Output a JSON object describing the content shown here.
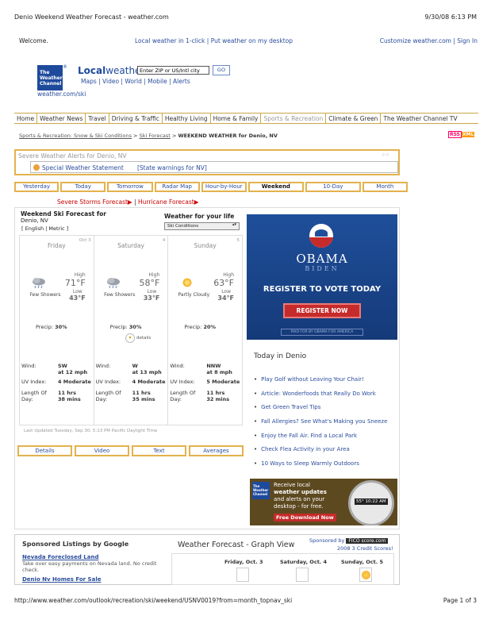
{
  "print_header": {
    "title": "Denio Weekend Weather Forecast - weather.com",
    "datetime": "9/30/08 6:13 PM"
  },
  "welcome": {
    "greeting": "Welcome.",
    "local_links": "Local weather in 1-click  |   Put weather on my desktop",
    "right_links": "Customize weather.com  | Sign In"
  },
  "logo": {
    "brand": "The Weather Channel",
    "reg": "®"
  },
  "local_weather": {
    "title_bold": "Local",
    "title_rest": "weather",
    "zip_value": "Enter ZIP or US/Intl city",
    "go_label": "GO",
    "sub_links": "Maps | Video | World | Mobile | Alerts",
    "site_url": "weather.com/ski"
  },
  "main_nav": [
    "Home",
    "Weather News",
    "Travel",
    "Driving & Traffic",
    "Healthy Living",
    "Home & Family",
    "Sports & Recreation",
    "Climate & Green",
    "The Weather Channel TV"
  ],
  "breadcrumb": {
    "crumb1": "Sports & Recreation: Snow & Ski Conditions",
    "sep": ">",
    "crumb2": "Ski Forecast",
    "current": "WEEKEND WEATHER for Denio, NV"
  },
  "rss": {
    "r": "RSS",
    "x": "XML"
  },
  "alerts": {
    "title": "Severe Weather Alerts for Denio, NV",
    "statement": "Special Weather Statement",
    "state_warnings": "[State warnings for NV]",
    "tiny": "▫ ▫"
  },
  "day_tabs": [
    "Yesterday",
    "Today",
    "Tomorrow",
    "Radar Map",
    "Hour-by-Hour",
    "Weekend",
    "10-Day",
    "Month"
  ],
  "storm_links": {
    "severe": "Severe Storms Forecast",
    "sep": " | ",
    "hurricane": "Hurricane Forecast"
  },
  "ski": {
    "title": "Weekend Ski Forecast for",
    "location": "Denio, NV",
    "units": "[ English | Metric ]",
    "life_title": "Weather for your life",
    "life_select": "Ski Conditions"
  },
  "days": [
    {
      "num": "Oct 3",
      "name": "Friday",
      "high_label": "High",
      "high": "71°F",
      "low_label": "Low",
      "low": "43°F",
      "cond": "Few Showers",
      "precip_label": "Precip:",
      "precip": "30%",
      "wind_label": "Wind:",
      "wind": "SW",
      "wind2": "at 12 mph",
      "uv_label": "UV Index:",
      "uv": "4 Moderate",
      "day_label": "Length Of",
      "day_label2": "Day:",
      "len": "11 hrs",
      "len2": "38 mins"
    },
    {
      "num": "4",
      "name": "Saturday",
      "high_label": "High",
      "high": "58°F",
      "low_label": "Low",
      "low": "33°F",
      "cond": "Few Showers",
      "precip_label": "Precip:",
      "precip": "30%",
      "wind_label": "Wind:",
      "wind": "W",
      "wind2": "at 13 mph",
      "uv_label": "UV Index:",
      "uv": "4 Moderate",
      "day_label": "Length Of",
      "day_label2": "Day:",
      "len": "11 hrs",
      "len2": "35 mins"
    },
    {
      "num": "5",
      "name": "Sunday",
      "high_label": "High",
      "high": "63°F",
      "low_label": "Low",
      "low": "34°F",
      "cond": "Partly Cloudy",
      "precip_label": "Precip:",
      "precip": "20%",
      "wind_label": "Wind:",
      "wind": "NNW",
      "wind2": "at 8 mph",
      "uv_label": "UV Index:",
      "uv": "5 Moderate",
      "day_label": "Length Of",
      "day_label2": "Day:",
      "len": "11 hrs",
      "len2": "32 mins"
    }
  ],
  "details_label": "details",
  "last_updated": "Last Updated Tuesday, Sep 30, 5:13 PM Pacific Daylight Time",
  "bottom_tabs": [
    "Details",
    "Video",
    "Text",
    "Averages"
  ],
  "obama_ad": {
    "obama": "OBAMA",
    "biden": "BIDEN",
    "headline": "REGISTER TO VOTE TODAY",
    "button": "REGISTER NOW",
    "paid": "PAID FOR BY OBAMA FOR AMERICA"
  },
  "today": {
    "title": "Today in Denio",
    "items": [
      "Play Golf without Leaving Your Chair!",
      "Article: Wonderfoods that Really Do Work",
      "Get Green Travel Tips",
      "Fall Allergies? See What's Making you Sneeze",
      "Enjoy the Fall Air. Find a Local Park",
      "Check Flea Activity in your Area",
      "10 Ways to Sleep Warmly Outdoors"
    ]
  },
  "twc_ad": {
    "logo": "The Weather Channel",
    "line1": "Receive local",
    "line2": "weather updates",
    "line3": "and alerts on your",
    "line4": "desktop - for free.",
    "download": "Free Download Now",
    "clock": "55° 10:22 AM"
  },
  "sponsored": {
    "title": "Sponsored Listings by Google",
    "l1": "Nevada Foreclosed Land",
    "l1d": "Take over easy payments on Nevada land. No credit check.",
    "l2": "Denio Nv Homes For Sale"
  },
  "graph": {
    "title": "Weather Forecast - Graph View",
    "sponsored_by": "Sponsored by",
    "badge": "FICO score.com",
    "credit": "2008 3 Credit Scores!",
    "days": [
      "Friday, Oct. 3",
      "Saturday, Oct. 4",
      "Sunday, Oct. 5"
    ]
  },
  "print_footer": {
    "url": "http://www.weather.com/outlook/recreation/ski/weekend/USNV0019?from=month_topnav_ski",
    "page": "Page 1 of 3"
  }
}
